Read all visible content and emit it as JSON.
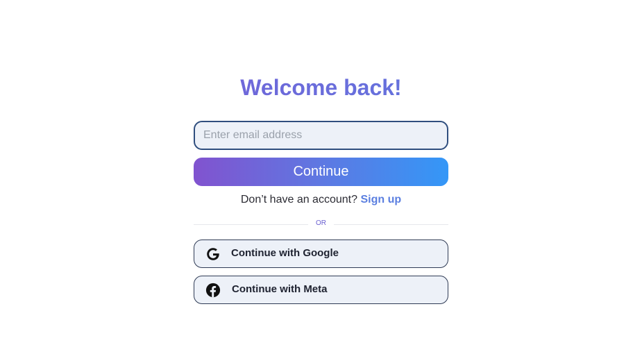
{
  "title": "Welcome back!",
  "email": {
    "placeholder": "Enter email address",
    "value": ""
  },
  "continue_label": "Continue",
  "signup": {
    "prompt": "Don’t have an account?",
    "link_label": "Sign up"
  },
  "divider_label": "OR",
  "social": {
    "google": {
      "label": "Continue with Google",
      "icon": "google-icon"
    },
    "meta": {
      "label": "Continue with Meta",
      "icon": "facebook-icon"
    }
  },
  "colors": {
    "accent_start": "#8153cf",
    "accent_end": "#3497f7",
    "field_bg": "#edf1f8",
    "field_border": "#2f4e7e"
  }
}
